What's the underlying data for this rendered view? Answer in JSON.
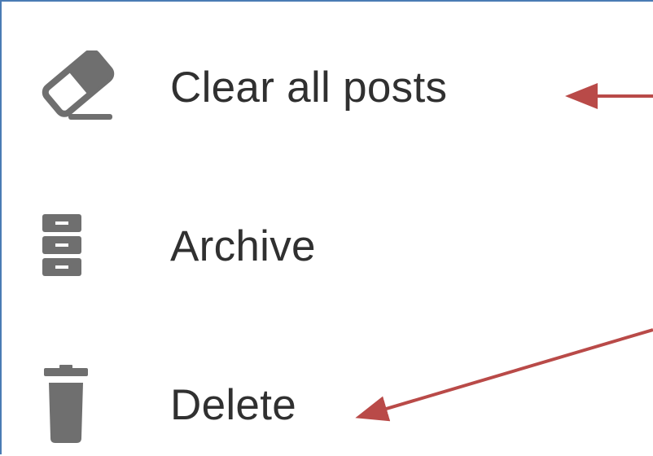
{
  "menu": {
    "items": [
      {
        "id": "clear",
        "label": "Clear all posts",
        "icon": "eraser-icon"
      },
      {
        "id": "archive",
        "label": "Archive",
        "icon": "archive-icon"
      },
      {
        "id": "delete",
        "label": "Delete",
        "icon": "trash-icon"
      }
    ]
  },
  "colors": {
    "text": "#303030",
    "icon": "#6f6f6f",
    "annotation_arrow": "#b94a48",
    "frame_border": "#4a7bb4"
  }
}
